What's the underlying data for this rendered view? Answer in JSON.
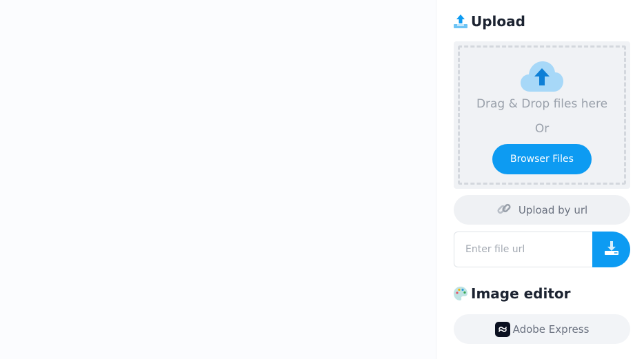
{
  "upload": {
    "title": "Upload",
    "title_icon": "upload-tray-icon",
    "dropzone_text": "Drag & Drop files here",
    "or_text": "Or",
    "browse_label": "Browser Files",
    "cloud_icon": "cloud-upload-icon"
  },
  "url_upload": {
    "label": "Upload by url",
    "icon": "link-icon",
    "input_placeholder": "Enter file url",
    "input_value": "",
    "submit_icon": "download-tray-icon"
  },
  "editor": {
    "title": "Image editor",
    "title_icon": "palette-icon",
    "adobe_label": "Adobe Express",
    "adobe_icon": "adobe-express-logo"
  },
  "colors": {
    "accent": "#0d9bf2",
    "button_bg": "#eff1f4",
    "text_dark": "#1c2331",
    "text_muted": "#9aa1ab"
  }
}
